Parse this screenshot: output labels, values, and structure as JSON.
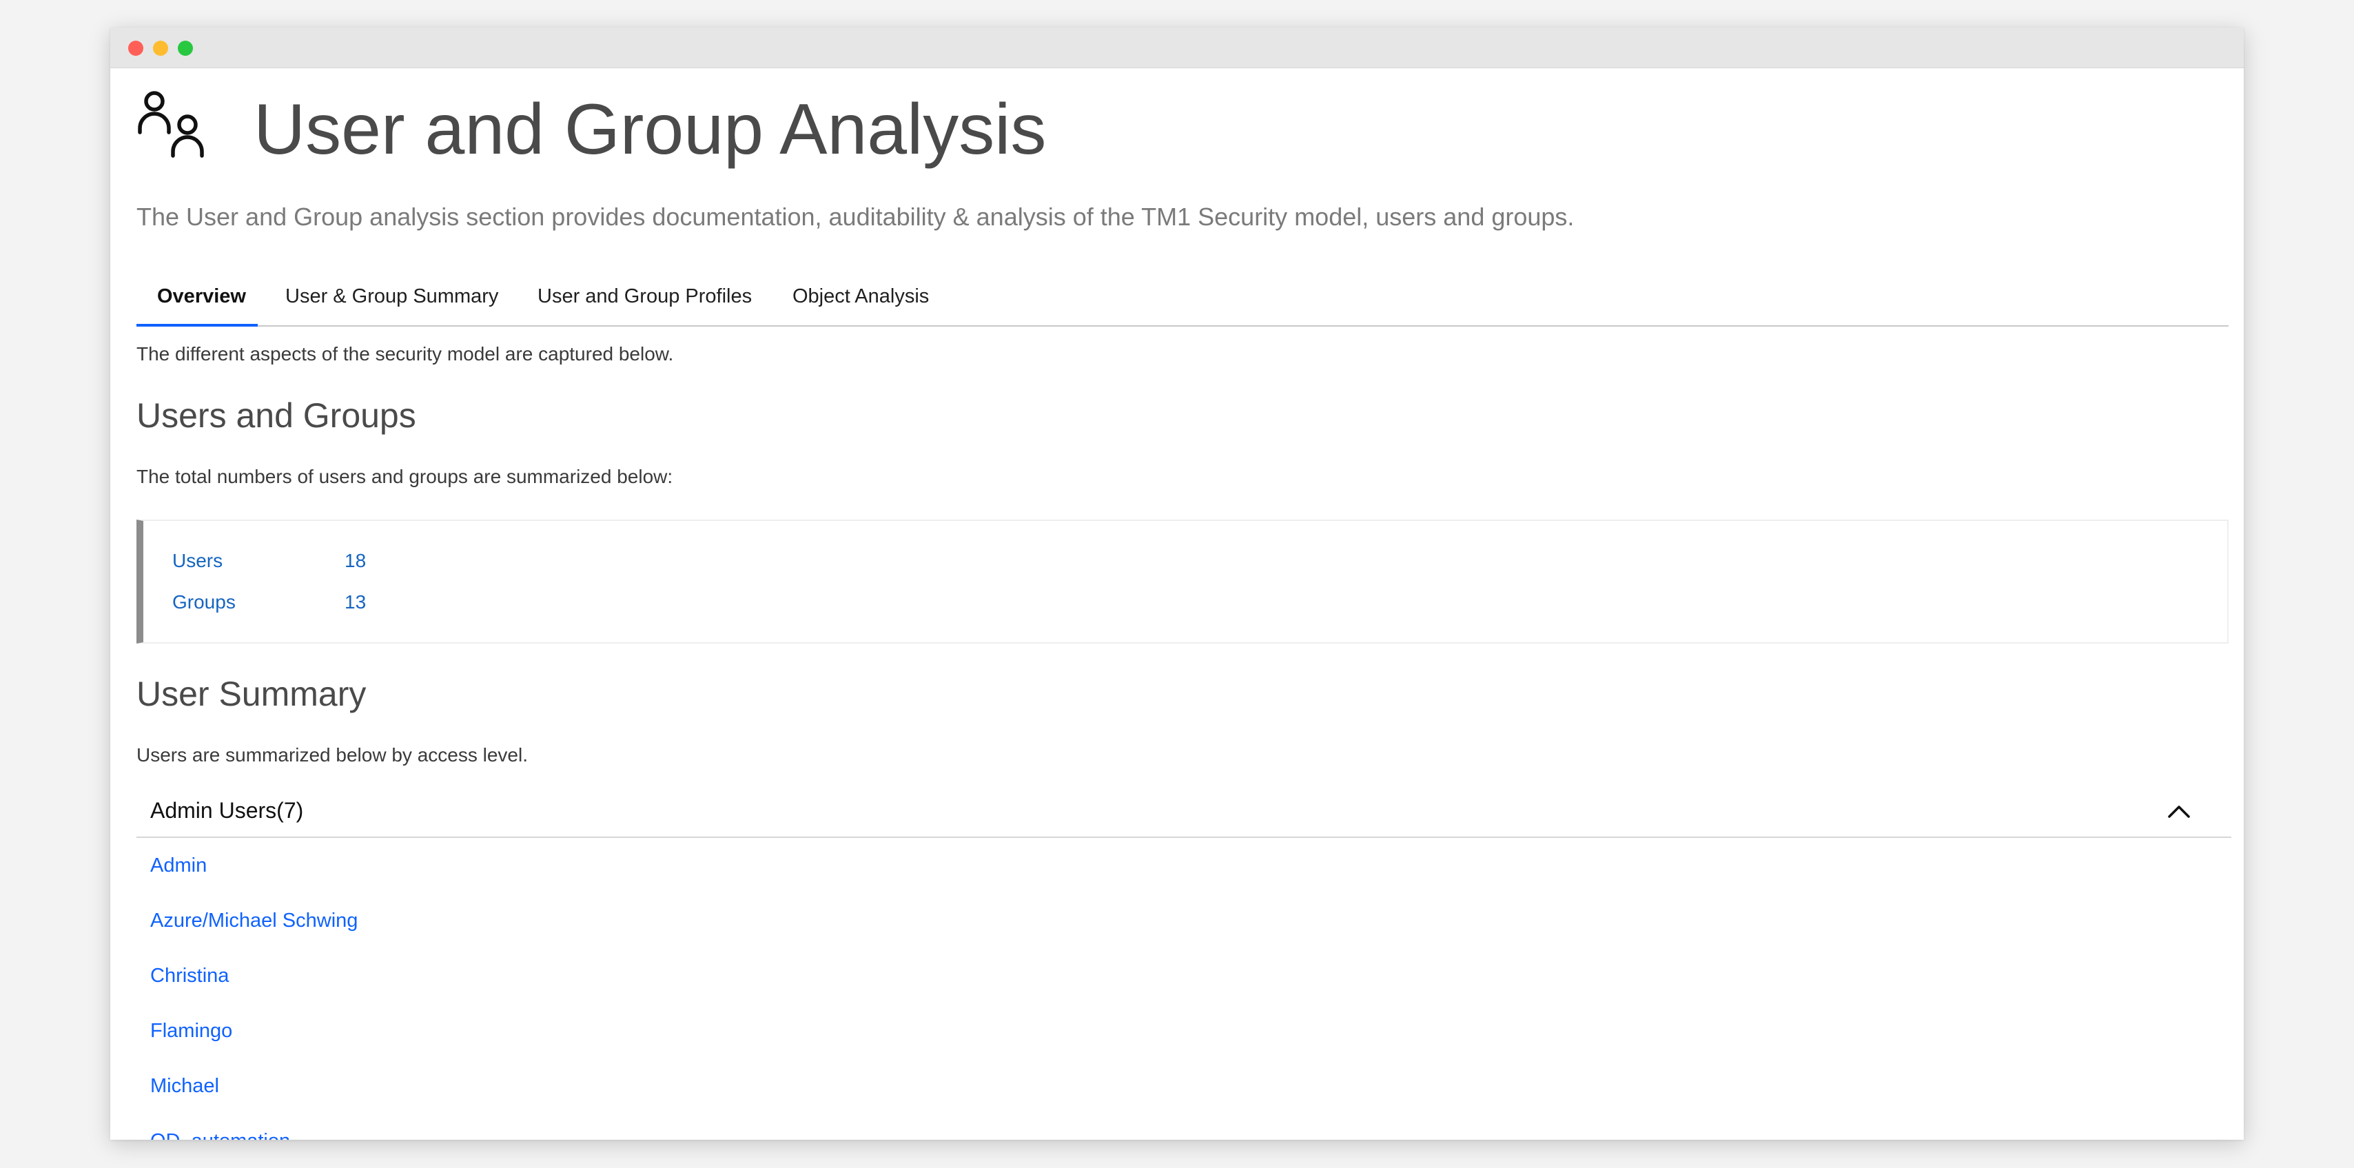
{
  "header": {
    "title": "User and Group Analysis",
    "subtitle": "The User and Group analysis section provides documentation, auditability & analysis of the TM1 Security model, users and groups.",
    "icon": "users-icon"
  },
  "tabs": [
    {
      "label": "Overview",
      "active": true
    },
    {
      "label": "User & Group Summary",
      "active": false
    },
    {
      "label": "User and Group Profiles",
      "active": false
    },
    {
      "label": "Object Analysis",
      "active": false
    }
  ],
  "overview": {
    "intro": "The different aspects of the security model are captured below.",
    "users_groups_heading": "Users and Groups",
    "users_groups_text": "The total numbers of users and groups are summarized below:",
    "counts": [
      {
        "label": "Users",
        "value": "18"
      },
      {
        "label": "Groups",
        "value": "13"
      }
    ],
    "user_summary_heading": "User Summary",
    "user_summary_text": "Users are summarized below by access level."
  },
  "accordion": {
    "title": "Admin Users(7)",
    "expanded": true,
    "items": [
      "Admin",
      "Azure/Michael Schwing",
      "Christina",
      "Flamingo",
      "Michael",
      "QD_automation"
    ]
  },
  "colors": {
    "accent": "#0f62fe",
    "link": "#0f62fe",
    "summary_value": "#1565c0",
    "title_text": "#4a4a4a"
  }
}
